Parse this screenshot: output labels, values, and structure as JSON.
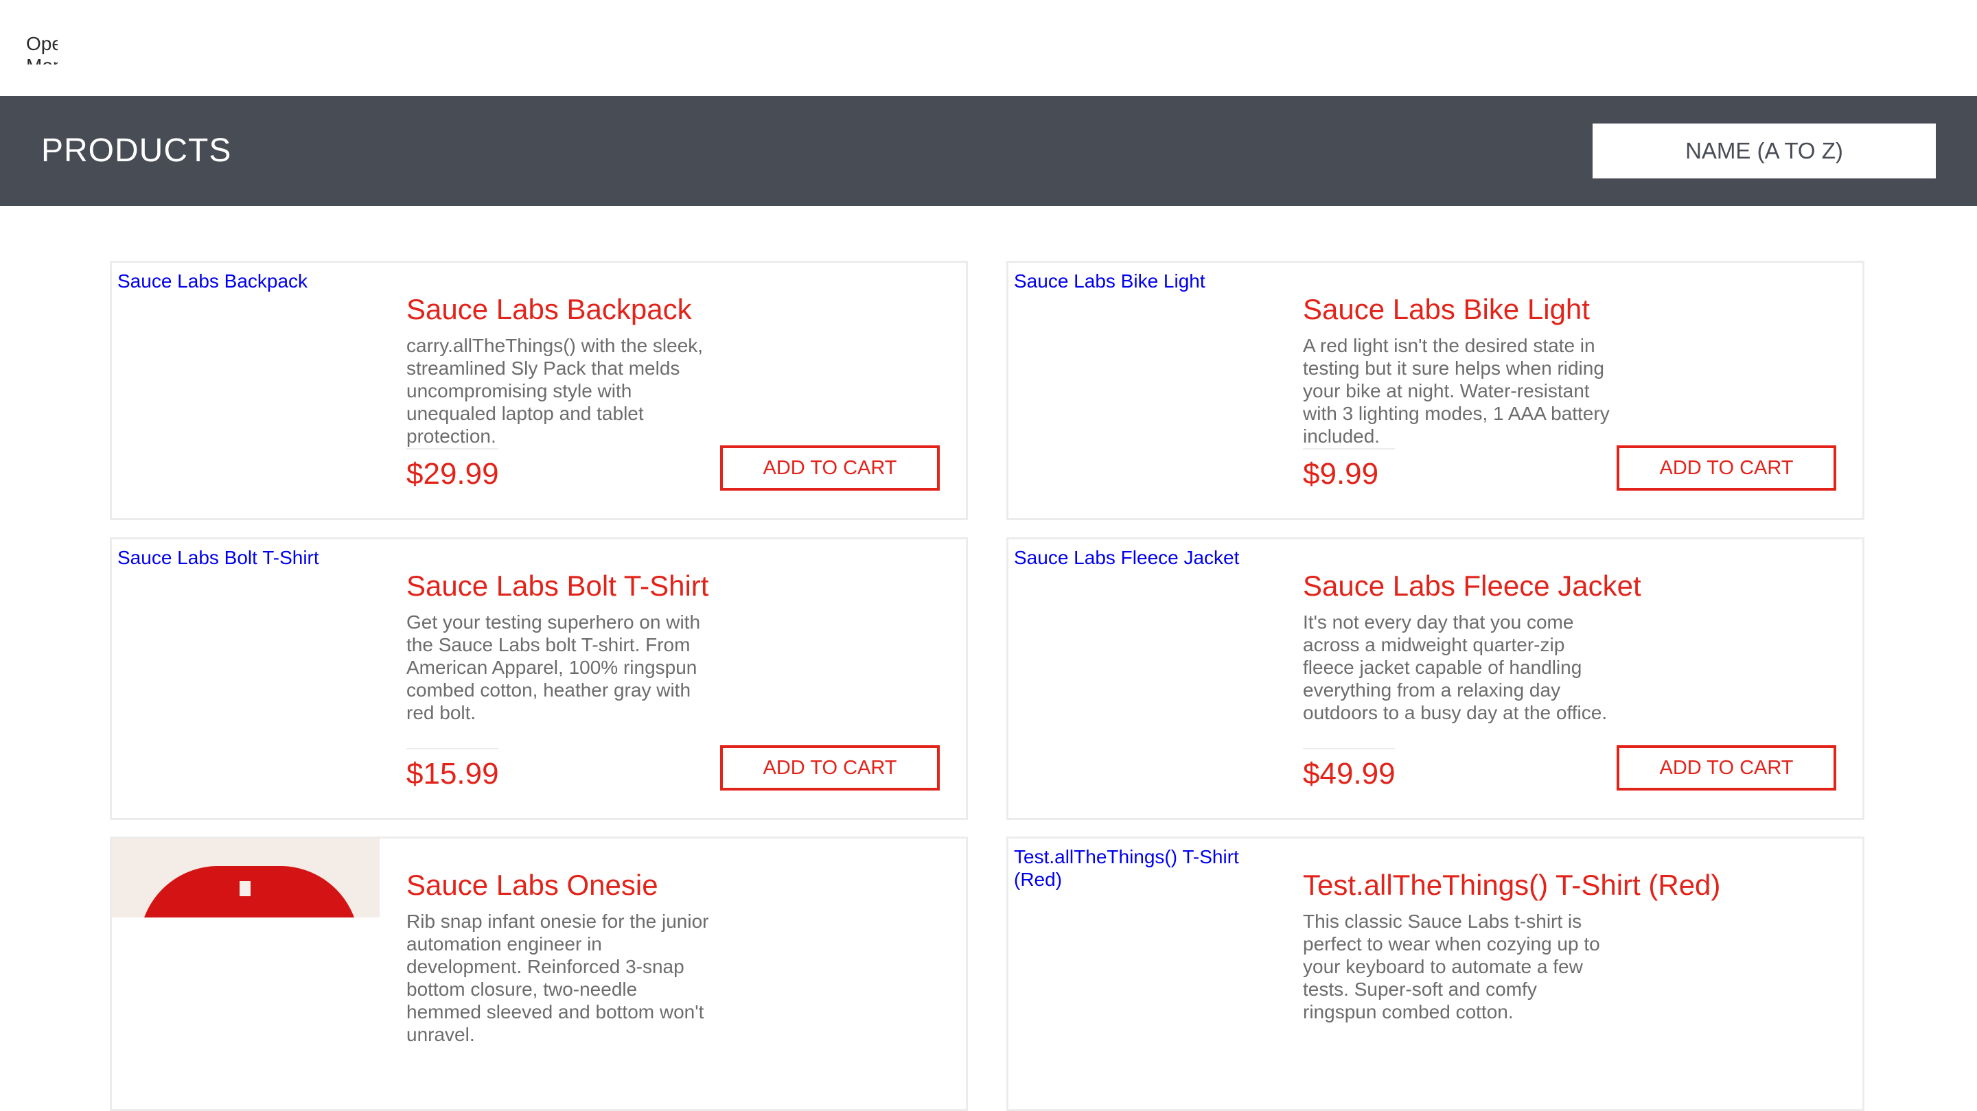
{
  "menu": {
    "label": "Open Menu"
  },
  "header": {
    "title": "PRODUCTS",
    "sort_label": "NAME (A TO Z)"
  },
  "products": [
    {
      "name": "Sauce Labs Backpack",
      "image_alt": "Sauce Labs Backpack",
      "description": "carry.allTheThings() with the sleek, streamlined Sly Pack that melds uncompromising style with unequaled laptop and tablet protection.",
      "price": "$29.99",
      "button": "ADD TO CART"
    },
    {
      "name": "Sauce Labs Bike Light",
      "image_alt": "Sauce Labs Bike Light",
      "description": "A red light isn't the desired state in testing but it sure helps when riding your bike at night. Water-resistant with 3 lighting modes, 1 AAA battery included.",
      "price": "$9.99",
      "button": "ADD TO CART"
    },
    {
      "name": "Sauce Labs Bolt T-Shirt",
      "image_alt": "Sauce Labs Bolt T-Shirt",
      "description": "Get your testing superhero on with the Sauce Labs bolt T-shirt. From American Apparel, 100% ringspun combed cotton, heather gray with red bolt.",
      "price": "$15.99",
      "button": "ADD TO CART"
    },
    {
      "name": "Sauce Labs Fleece Jacket",
      "image_alt": "Sauce Labs Fleece Jacket",
      "description": "It's not every day that you come across a midweight quarter-zip fleece jacket capable of handling everything from a relaxing day outdoors to a busy day at the office.",
      "price": "$49.99",
      "button": "ADD TO CART"
    },
    {
      "name": "Sauce Labs Onesie",
      "image_alt": "",
      "description": "Rib snap infant onesie for the junior automation engineer in development. Reinforced 3-snap bottom closure, two-needle hemmed sleeved and bottom won't unravel."
    },
    {
      "name": "Test.allTheThings() T-Shirt (Red)",
      "image_alt": "Test.allTheThings() T-Shirt (Red)",
      "description": "This classic Sauce Labs t-shirt is perfect to wear when cozying up to your keyboard to automate a few tests. Super-soft and comfy ringspun combed cotton."
    }
  ]
}
